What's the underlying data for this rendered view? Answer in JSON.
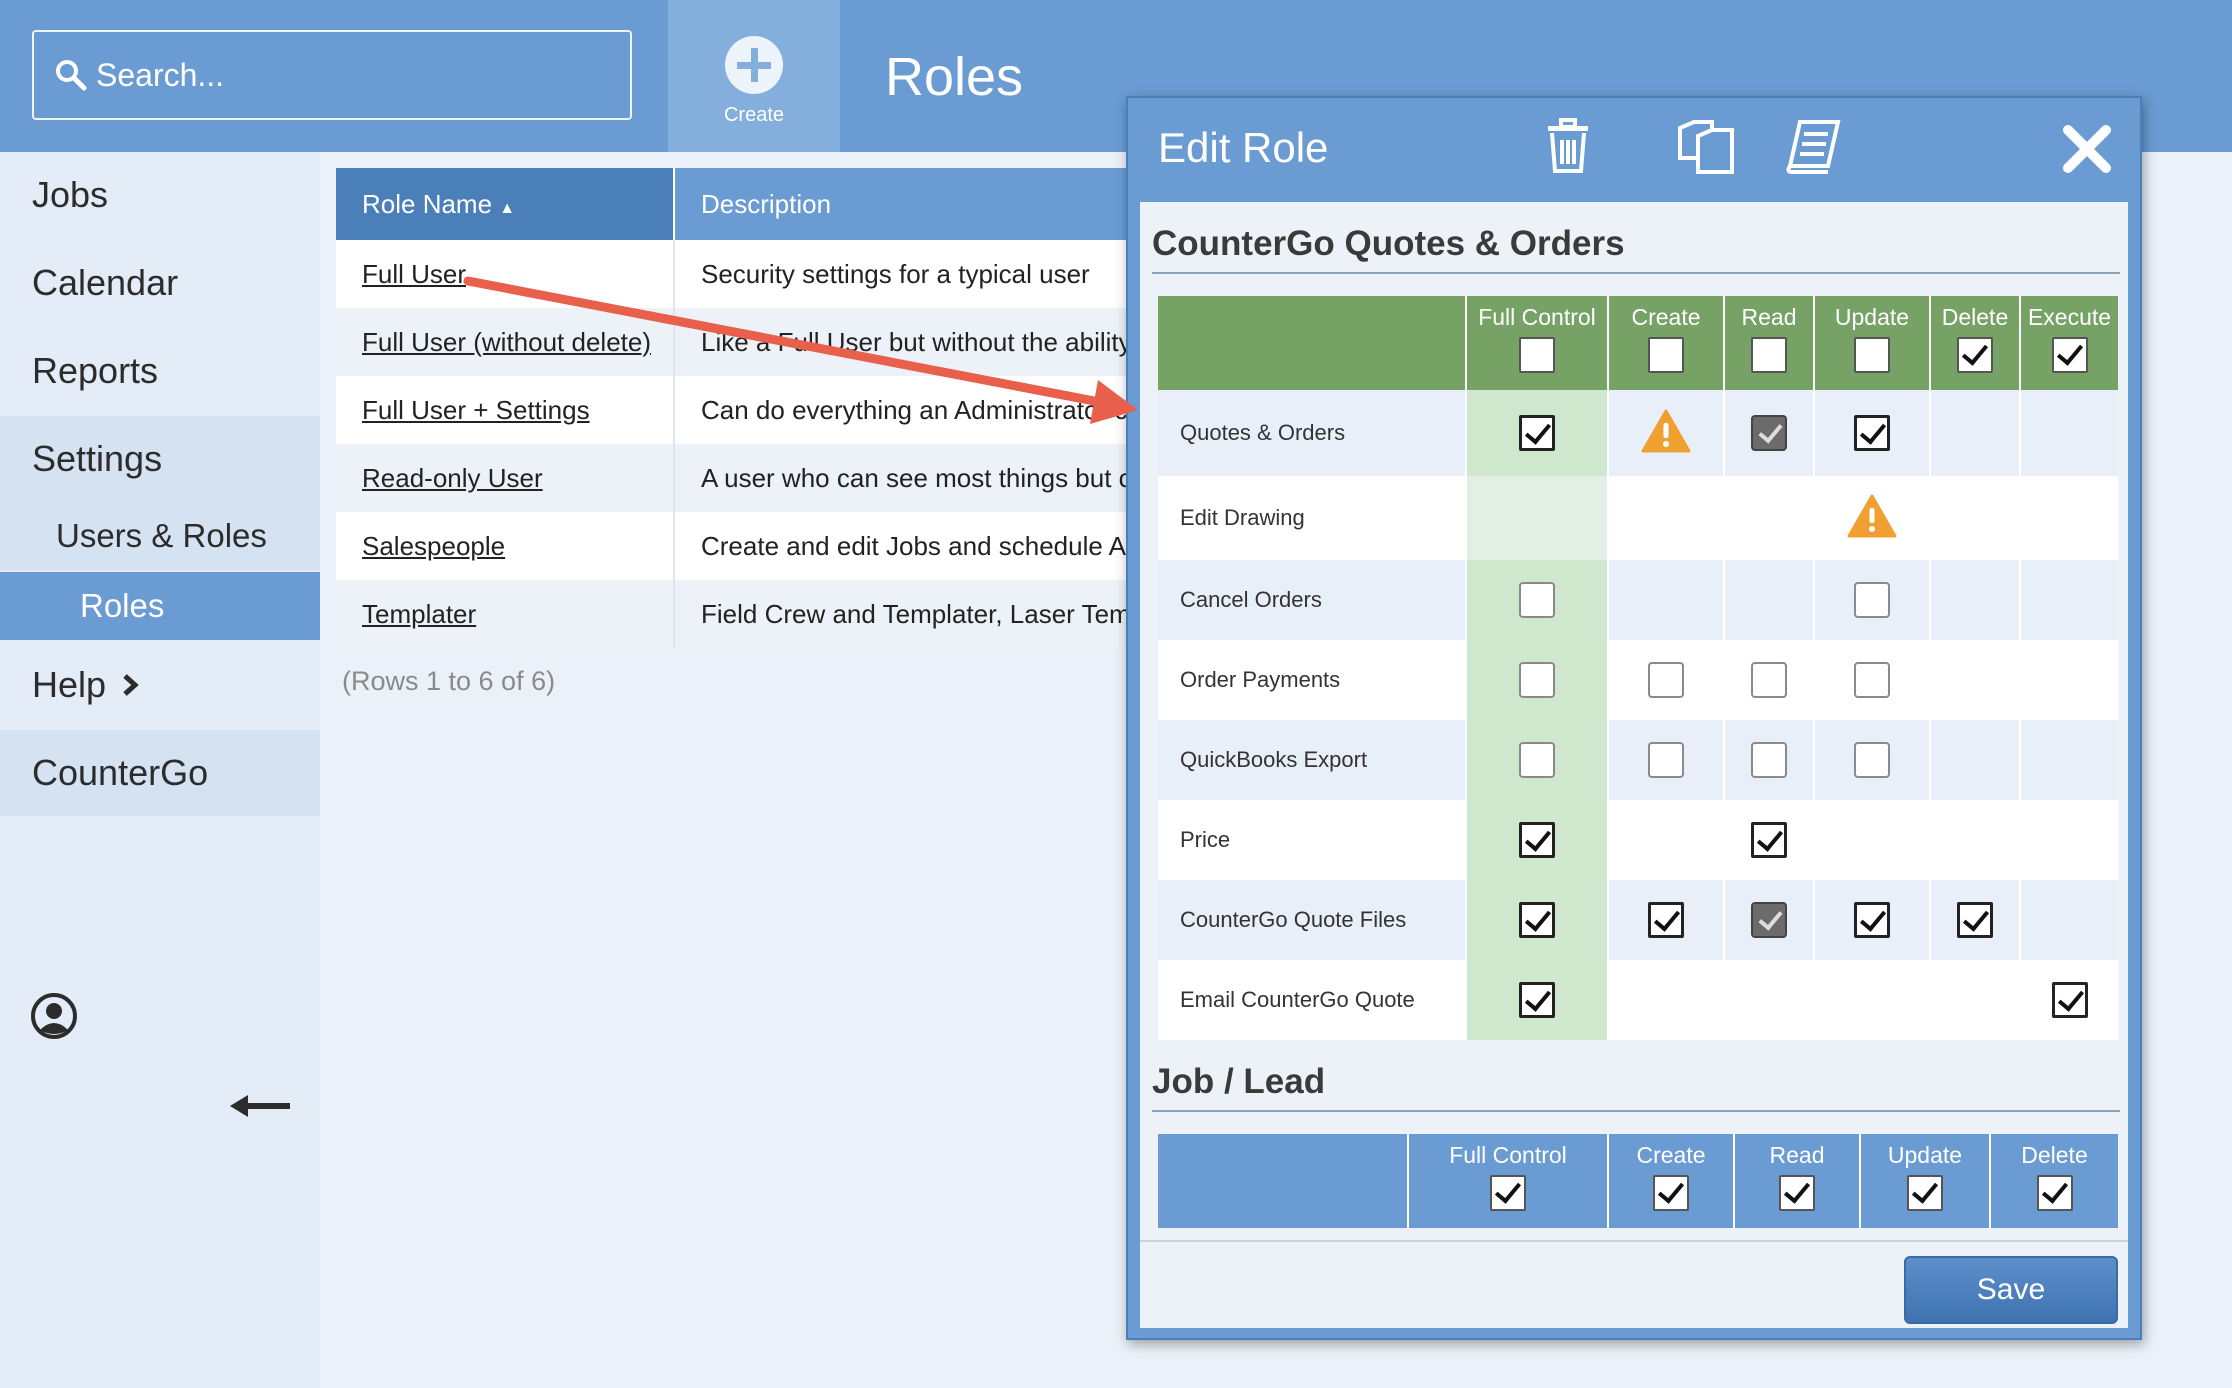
{
  "header": {
    "search_placeholder": "Search...",
    "create_label": "Create",
    "page_title": "Roles"
  },
  "sidebar": {
    "items": [
      {
        "label": "Jobs"
      },
      {
        "label": "Calendar"
      },
      {
        "label": "Reports"
      },
      {
        "label": "Settings"
      },
      {
        "label": "Users & Roles"
      },
      {
        "label": "Roles"
      },
      {
        "label": "Help"
      },
      {
        "label": "CounterGo"
      }
    ]
  },
  "roles_table": {
    "columns": [
      "Role Name",
      "Description"
    ],
    "rows": [
      {
        "name": "Full User",
        "description": "Security settings for a typical user"
      },
      {
        "name": "Full User (without delete)",
        "description": "Like a Full User but without the ability"
      },
      {
        "name": "Full User + Settings",
        "description": "Can do everything an Administrator c"
      },
      {
        "name": "Read-only User",
        "description": "A user who can see most things but ca"
      },
      {
        "name": "Salespeople",
        "description": "Create and edit Jobs and schedule Act"
      },
      {
        "name": "Templater",
        "description": "Field Crew and Templater, Laser Temp"
      }
    ],
    "rows_count": "(Rows 1 to 6 of 6)"
  },
  "modal": {
    "title": "Edit Role",
    "save_label": "Save",
    "sections": [
      {
        "title": "CounterGo Quotes & Orders",
        "columns": [
          "Full Control",
          "Create",
          "Read",
          "Update",
          "Delete",
          "Execute"
        ],
        "header_checks": [
          "off",
          "off",
          "off",
          "off",
          "on",
          "on"
        ],
        "rows": [
          {
            "label": "Quotes & Orders",
            "cells": [
              "on",
              "warn",
              "dis",
              "on",
              "",
              ""
            ]
          },
          {
            "label": "Edit Drawing",
            "cells": [
              "",
              "",
              "",
              "warn",
              "",
              ""
            ]
          },
          {
            "label": "Cancel Orders",
            "cells": [
              "off",
              "",
              "",
              "off",
              "",
              ""
            ]
          },
          {
            "label": "Order Payments",
            "cells": [
              "off",
              "off",
              "off",
              "off",
              "",
              ""
            ]
          },
          {
            "label": "QuickBooks Export",
            "cells": [
              "off",
              "off",
              "off",
              "off",
              "",
              ""
            ]
          },
          {
            "label": "Price",
            "cells": [
              "on",
              "",
              "on",
              "",
              "",
              ""
            ]
          },
          {
            "label": "CounterGo Quote Files",
            "cells": [
              "on",
              "on",
              "dis",
              "on",
              "on",
              ""
            ]
          },
          {
            "label": "Email CounterGo Quote",
            "cells": [
              "on",
              "",
              "",
              "",
              "",
              "on"
            ]
          }
        ]
      },
      {
        "title": "Job / Lead",
        "columns": [
          "Full Control",
          "Create",
          "Read",
          "Update",
          "Delete"
        ],
        "header_checks": [
          "on",
          "on",
          "on",
          "on",
          "on"
        ]
      }
    ]
  },
  "colors": {
    "topbar": "#6a9cd3",
    "accent_dark": "#4a7fb9",
    "section1_header": "#76a266",
    "full_control_column": "#cfe8cd",
    "warning": "#f0a030",
    "annotation_arrow": "#e8604c"
  }
}
